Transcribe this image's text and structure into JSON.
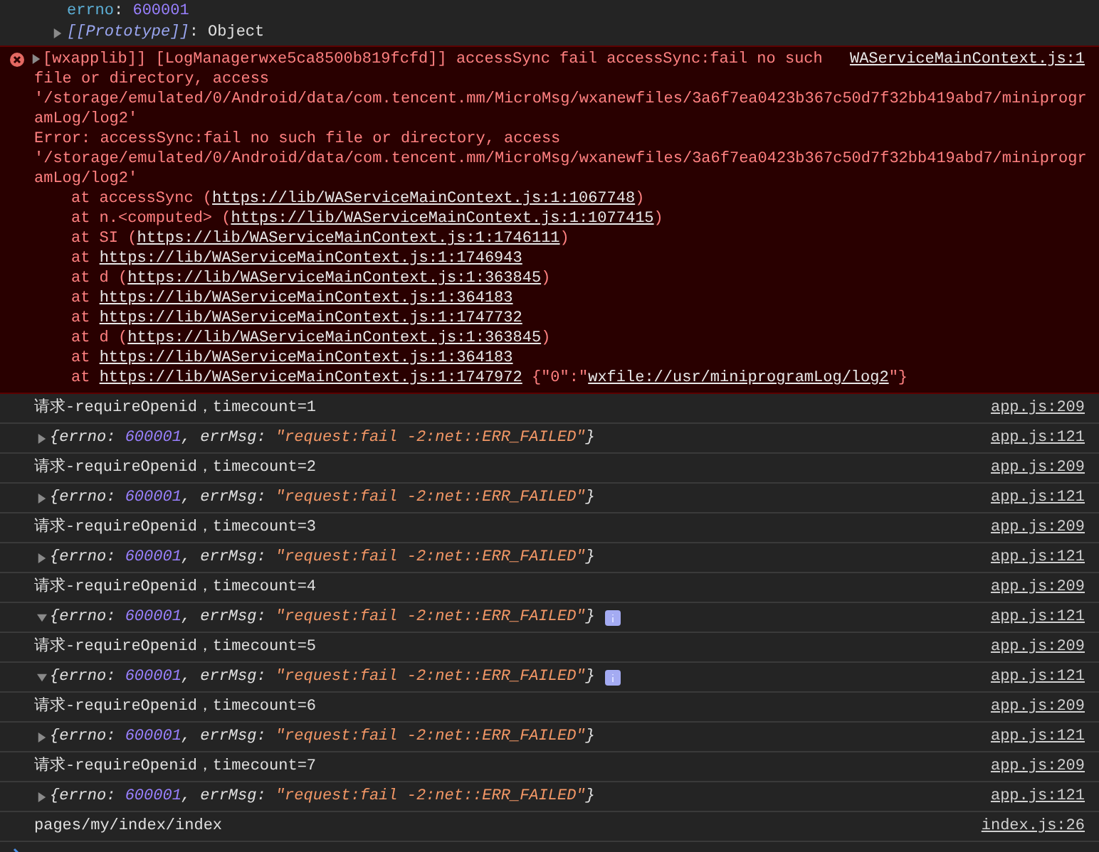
{
  "expanded_object": {
    "properties": [
      {
        "parts": [
          {
            "kind": "key",
            "text": "errno"
          },
          {
            "kind": "plain",
            "text": ": "
          },
          {
            "kind": "number",
            "text": "600001"
          }
        ]
      }
    ],
    "prototype": {
      "expanded": false,
      "parts": [
        {
          "kind": "internal",
          "text": "[[Prototype]]"
        },
        {
          "kind": "plain",
          "text": ": Object"
        }
      ]
    }
  },
  "error_message": {
    "expanded": false,
    "source": "WAServiceMainContext.js:1",
    "message_lines": [
      "[wxapplib]] [LogManagerwxe5ca8500b819fcfd]] accessSync fail accessSync:fail no such",
      "file or directory, access",
      "'/storage/emulated/0/Android/data/com.tencent.mm/MicroMsg/wxanewfiles/3a6f7ea0423b367c50d7f32bb419abd7/miniprogr",
      "amLog/log2'",
      "Error: accessSync:fail no such file or directory, access",
      "'/storage/emulated/0/Android/data/com.tencent.mm/MicroMsg/wxanewfiles/3a6f7ea0423b367c50d7f32bb419abd7/miniprogr",
      "amLog/log2'"
    ],
    "stack": [
      [
        {
          "kind": "err",
          "text": "at accessSync ("
        },
        {
          "kind": "link",
          "text": "https://lib/WAServiceMainContext.js:1:1067748"
        },
        {
          "kind": "err",
          "text": ")"
        }
      ],
      [
        {
          "kind": "err",
          "text": "at n.<computed> ("
        },
        {
          "kind": "link",
          "text": "https://lib/WAServiceMainContext.js:1:1077415"
        },
        {
          "kind": "err",
          "text": ")"
        }
      ],
      [
        {
          "kind": "err",
          "text": "at SI ("
        },
        {
          "kind": "link",
          "text": "https://lib/WAServiceMainContext.js:1:1746111"
        },
        {
          "kind": "err",
          "text": ")"
        }
      ],
      [
        {
          "kind": "err",
          "text": "at "
        },
        {
          "kind": "link",
          "text": "https://lib/WAServiceMainContext.js:1:1746943"
        }
      ],
      [
        {
          "kind": "err",
          "text": "at d ("
        },
        {
          "kind": "link",
          "text": "https://lib/WAServiceMainContext.js:1:363845"
        },
        {
          "kind": "err",
          "text": ")"
        }
      ],
      [
        {
          "kind": "err",
          "text": "at "
        },
        {
          "kind": "link",
          "text": "https://lib/WAServiceMainContext.js:1:364183"
        }
      ],
      [
        {
          "kind": "err",
          "text": "at "
        },
        {
          "kind": "link",
          "text": "https://lib/WAServiceMainContext.js:1:1747732"
        }
      ],
      [
        {
          "kind": "err",
          "text": "at d ("
        },
        {
          "kind": "link",
          "text": "https://lib/WAServiceMainContext.js:1:363845"
        },
        {
          "kind": "err",
          "text": ")"
        }
      ],
      [
        {
          "kind": "err",
          "text": "at "
        },
        {
          "kind": "link",
          "text": "https://lib/WAServiceMainContext.js:1:364183"
        }
      ],
      [
        {
          "kind": "err",
          "text": "at "
        },
        {
          "kind": "link",
          "text": "https://lib/WAServiceMainContext.js:1:1747972"
        },
        {
          "kind": "err",
          "text": " {\"0\":\""
        },
        {
          "kind": "link",
          "text": "wxfile://usr/miniprogramLog/log2"
        },
        {
          "kind": "err",
          "text": "\"}"
        }
      ]
    ]
  },
  "logs": [
    {
      "kind": "text",
      "text": "请求-requireOpenid，timecount=1",
      "source": "app.js:209"
    },
    {
      "kind": "object",
      "expanded": false,
      "info_badge": false,
      "source": "app.js:121",
      "parts": [
        {
          "kind": "plain",
          "text": "{errno: "
        },
        {
          "kind": "number",
          "text": "600001"
        },
        {
          "kind": "plain",
          "text": ", errMsg: "
        },
        {
          "kind": "string",
          "text": "\"request:fail -2:net::ERR_FAILED\""
        },
        {
          "kind": "plain",
          "text": "}"
        }
      ]
    },
    {
      "kind": "text",
      "text": "请求-requireOpenid，timecount=2",
      "source": "app.js:209"
    },
    {
      "kind": "object",
      "expanded": false,
      "info_badge": false,
      "source": "app.js:121",
      "parts": [
        {
          "kind": "plain",
          "text": "{errno: "
        },
        {
          "kind": "number",
          "text": "600001"
        },
        {
          "kind": "plain",
          "text": ", errMsg: "
        },
        {
          "kind": "string",
          "text": "\"request:fail -2:net::ERR_FAILED\""
        },
        {
          "kind": "plain",
          "text": "}"
        }
      ]
    },
    {
      "kind": "text",
      "text": "请求-requireOpenid，timecount=3",
      "source": "app.js:209"
    },
    {
      "kind": "object",
      "expanded": false,
      "info_badge": false,
      "source": "app.js:121",
      "parts": [
        {
          "kind": "plain",
          "text": "{errno: "
        },
        {
          "kind": "number",
          "text": "600001"
        },
        {
          "kind": "plain",
          "text": ", errMsg: "
        },
        {
          "kind": "string",
          "text": "\"request:fail -2:net::ERR_FAILED\""
        },
        {
          "kind": "plain",
          "text": "}"
        }
      ]
    },
    {
      "kind": "text",
      "text": "请求-requireOpenid，timecount=4",
      "source": "app.js:209"
    },
    {
      "kind": "object",
      "expanded": true,
      "info_badge": true,
      "source": "app.js:121",
      "parts": [
        {
          "kind": "plain",
          "text": "{errno: "
        },
        {
          "kind": "number",
          "text": "600001"
        },
        {
          "kind": "plain",
          "text": ", errMsg: "
        },
        {
          "kind": "string",
          "text": "\"request:fail -2:net::ERR_FAILED\""
        },
        {
          "kind": "plain",
          "text": "}"
        }
      ]
    },
    {
      "kind": "text",
      "text": "请求-requireOpenid，timecount=5",
      "source": "app.js:209"
    },
    {
      "kind": "object",
      "expanded": true,
      "info_badge": true,
      "source": "app.js:121",
      "parts": [
        {
          "kind": "plain",
          "text": "{errno: "
        },
        {
          "kind": "number",
          "text": "600001"
        },
        {
          "kind": "plain",
          "text": ", errMsg: "
        },
        {
          "kind": "string",
          "text": "\"request:fail -2:net::ERR_FAILED\""
        },
        {
          "kind": "plain",
          "text": "}"
        }
      ]
    },
    {
      "kind": "text",
      "text": "请求-requireOpenid，timecount=6",
      "source": "app.js:209"
    },
    {
      "kind": "object",
      "expanded": false,
      "info_badge": false,
      "source": "app.js:121",
      "parts": [
        {
          "kind": "plain",
          "text": "{errno: "
        },
        {
          "kind": "number",
          "text": "600001"
        },
        {
          "kind": "plain",
          "text": ", errMsg: "
        },
        {
          "kind": "string",
          "text": "\"request:fail -2:net::ERR_FAILED\""
        },
        {
          "kind": "plain",
          "text": "}"
        }
      ]
    },
    {
      "kind": "text",
      "text": "请求-requireOpenid，timecount=7",
      "source": "app.js:209"
    },
    {
      "kind": "object",
      "expanded": false,
      "info_badge": false,
      "source": "app.js:121",
      "parts": [
        {
          "kind": "plain",
          "text": "{errno: "
        },
        {
          "kind": "number",
          "text": "600001"
        },
        {
          "kind": "plain",
          "text": ", errMsg: "
        },
        {
          "kind": "string",
          "text": "\"request:fail -2:net::ERR_FAILED\""
        },
        {
          "kind": "plain",
          "text": "}"
        }
      ]
    },
    {
      "kind": "text",
      "text": "pages/my/index/index",
      "source": "index.js:26"
    }
  ]
}
